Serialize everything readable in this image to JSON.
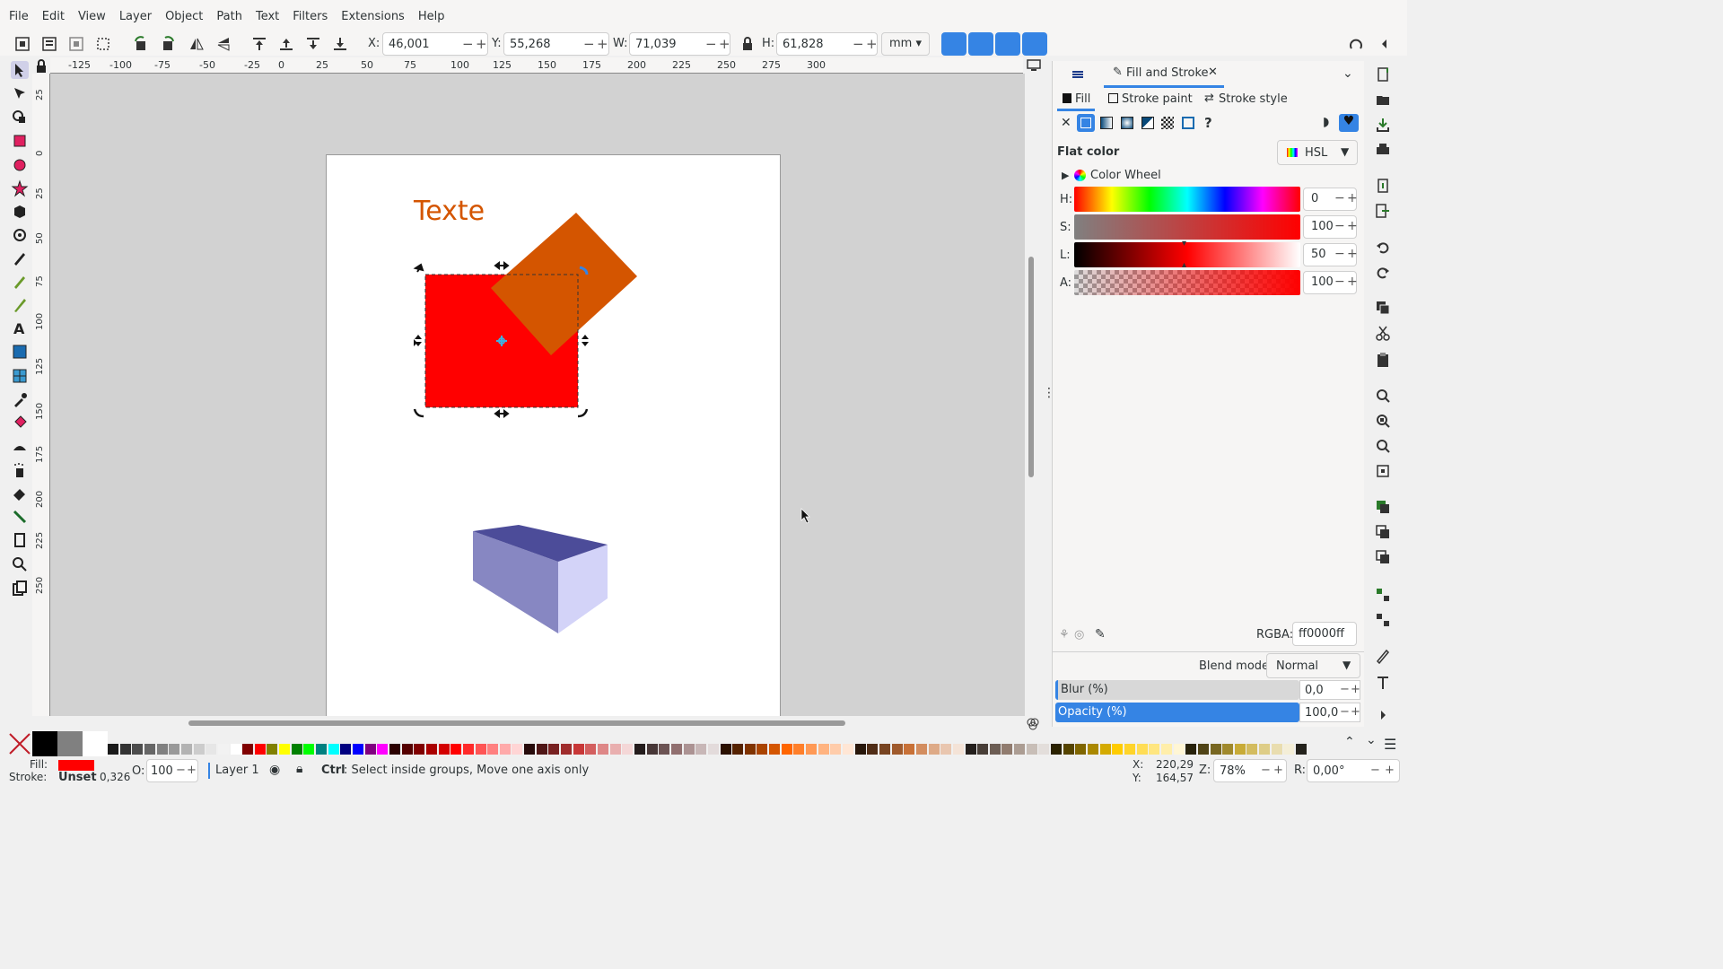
{
  "menu": [
    "File",
    "Edit",
    "View",
    "Layer",
    "Object",
    "Path",
    "Text",
    "Filters",
    "Extensions",
    "Help"
  ],
  "toolbar": {
    "x_label": "X:",
    "x_value": "46,001",
    "y_label": "Y:",
    "y_value": "55,268",
    "w_label": "W:",
    "w_value": "71,039",
    "h_label": "H:",
    "h_value": "61,828",
    "unit": "mm"
  },
  "ruler_top": [
    "-125",
    "-100",
    "-75",
    "-50",
    "-25",
    "0",
    "25",
    "50",
    "75",
    "100",
    "125",
    "150",
    "175",
    "200",
    "225",
    "250",
    "275",
    "300"
  ],
  "ruler_left": [
    "25",
    "0",
    "25",
    "50",
    "75",
    "100",
    "125",
    "150",
    "175",
    "200",
    "225",
    "250"
  ],
  "canvas": {
    "text_object": "Texte",
    "text_color": "#d45500",
    "rect_color": "#ff0000",
    "diamond_color": "#d45500",
    "box_top": "#4c4c99",
    "box_left": "#8787c2",
    "box_right": "#d3d3f8"
  },
  "panel": {
    "tab_title": "Fill and Stroke",
    "subtabs": [
      "Fill",
      "Stroke paint",
      "Stroke style"
    ],
    "flat_color_label": "Flat color",
    "mode": "HSL",
    "color_wheel_label": "Color Wheel",
    "sliders": [
      {
        "label": "H:",
        "value": "0"
      },
      {
        "label": "S:",
        "value": "100"
      },
      {
        "label": "L:",
        "value": "50"
      },
      {
        "label": "A:",
        "value": "100"
      }
    ],
    "rgba_label": "RGBA:",
    "rgba_value": "ff0000ff",
    "blend_label": "Blend mode:",
    "blend_value": "Normal",
    "blur_label": "Blur (%)",
    "blur_value": "0,0",
    "opacity_label": "Opacity (%)",
    "opacity_value": "100,0"
  },
  "palette_colors": [
    "#000000",
    "#808080",
    "#ffffff",
    "#1a1a1a",
    "#333333",
    "#4d4d4d",
    "#666666",
    "#808080",
    "#999999",
    "#b3b3b3",
    "#cccccc",
    "#e6e6e6",
    "#f2f2f2",
    "#ffffff",
    "#800000",
    "#ff0000",
    "#808000",
    "#ffff00",
    "#008000",
    "#00ff00",
    "#008080",
    "#00ffff",
    "#000080",
    "#0000ff",
    "#800080",
    "#ff00ff",
    "#2b0000",
    "#550000",
    "#800000",
    "#aa0000",
    "#d40000",
    "#ff0000",
    "#ff2a2a",
    "#ff5555",
    "#ff8080",
    "#ffaaaa",
    "#ffd5d5",
    "#280b0b",
    "#501616",
    "#782121",
    "#a02c2c",
    "#c83737",
    "#d35f5f",
    "#de8787",
    "#e9afaf",
    "#f4d7d7",
    "#241c1c",
    "#483737",
    "#6c5353",
    "#916f6f",
    "#ac9393",
    "#c8b7b7",
    "#e3dbdb",
    "#2b1100",
    "#552200",
    "#803300",
    "#aa4400",
    "#d45500",
    "#ff6600",
    "#ff7f2a",
    "#ff9955",
    "#ffb380",
    "#ffccaa",
    "#ffe6d5",
    "#28170b",
    "#502d16",
    "#784421",
    "#a05a2c",
    "#c87137",
    "#d38d5f",
    "#deaa87",
    "#e9c6af",
    "#f4e3d7",
    "#241f1c",
    "#483e37",
    "#6c5d53",
    "#917c6f",
    "#ac9d93",
    "#c8beb7",
    "#e3dedb",
    "#2b2200",
    "#554400",
    "#806600",
    "#aa8800",
    "#d4aa00",
    "#ffcc00",
    "#ffd42a",
    "#ffdd55",
    "#ffe680",
    "#ffeeaa",
    "#fff6d5",
    "#28220b",
    "#504416",
    "#786721",
    "#a0892c",
    "#c8ab37",
    "#d3bc5f",
    "#decd87",
    "#e9ddaf",
    "#f4eed7",
    "#24221c"
  ],
  "status": {
    "fill_label": "Fill:",
    "fill_color": "#ff0000",
    "stroke_label": "Stroke:",
    "stroke_value": "Unset",
    "stroke_width": "0,326",
    "opacity_label": "O:",
    "opacity_value": "100",
    "layer": "Layer 1",
    "hint_bold": "Ctrl",
    "hint_text": ": Select inside groups, Move one axis only",
    "x_label": "X:",
    "x_value": "220,29",
    "y_label": "Y:",
    "y_value": "164,57",
    "zoom_label": "Z:",
    "zoom_value": "78%",
    "rot_label": "R:",
    "rot_value": "0,00°"
  }
}
